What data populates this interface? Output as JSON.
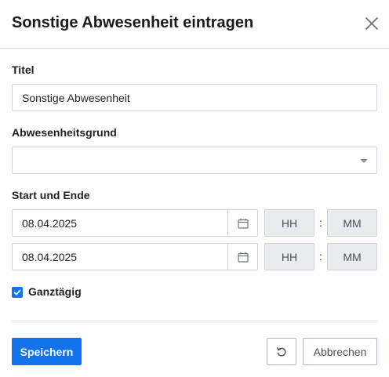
{
  "dialog": {
    "title": "Sonstige Abwesenheit eintragen",
    "close_icon": "close-icon"
  },
  "form": {
    "title_label": "Titel",
    "title_value": "Sonstige Abwesenheit",
    "reason_label": "Abwesenheitsgrund",
    "reason_value": "",
    "start_end_label": "Start und Ende",
    "start": {
      "date": "08.04.2025",
      "hour_placeholder": "HH",
      "minute_placeholder": "MM"
    },
    "end": {
      "date": "08.04.2025",
      "hour_placeholder": "HH",
      "minute_placeholder": "MM"
    },
    "time_separator": ":",
    "all_day_label": "Ganztägig",
    "all_day_checked": true
  },
  "footer": {
    "save_label": "Speichern",
    "reset_icon": "reset-icon",
    "cancel_label": "Abbrechen"
  },
  "colors": {
    "primary": "#1273eb",
    "border": "#ced4da",
    "time_bg": "#e9ecef"
  }
}
